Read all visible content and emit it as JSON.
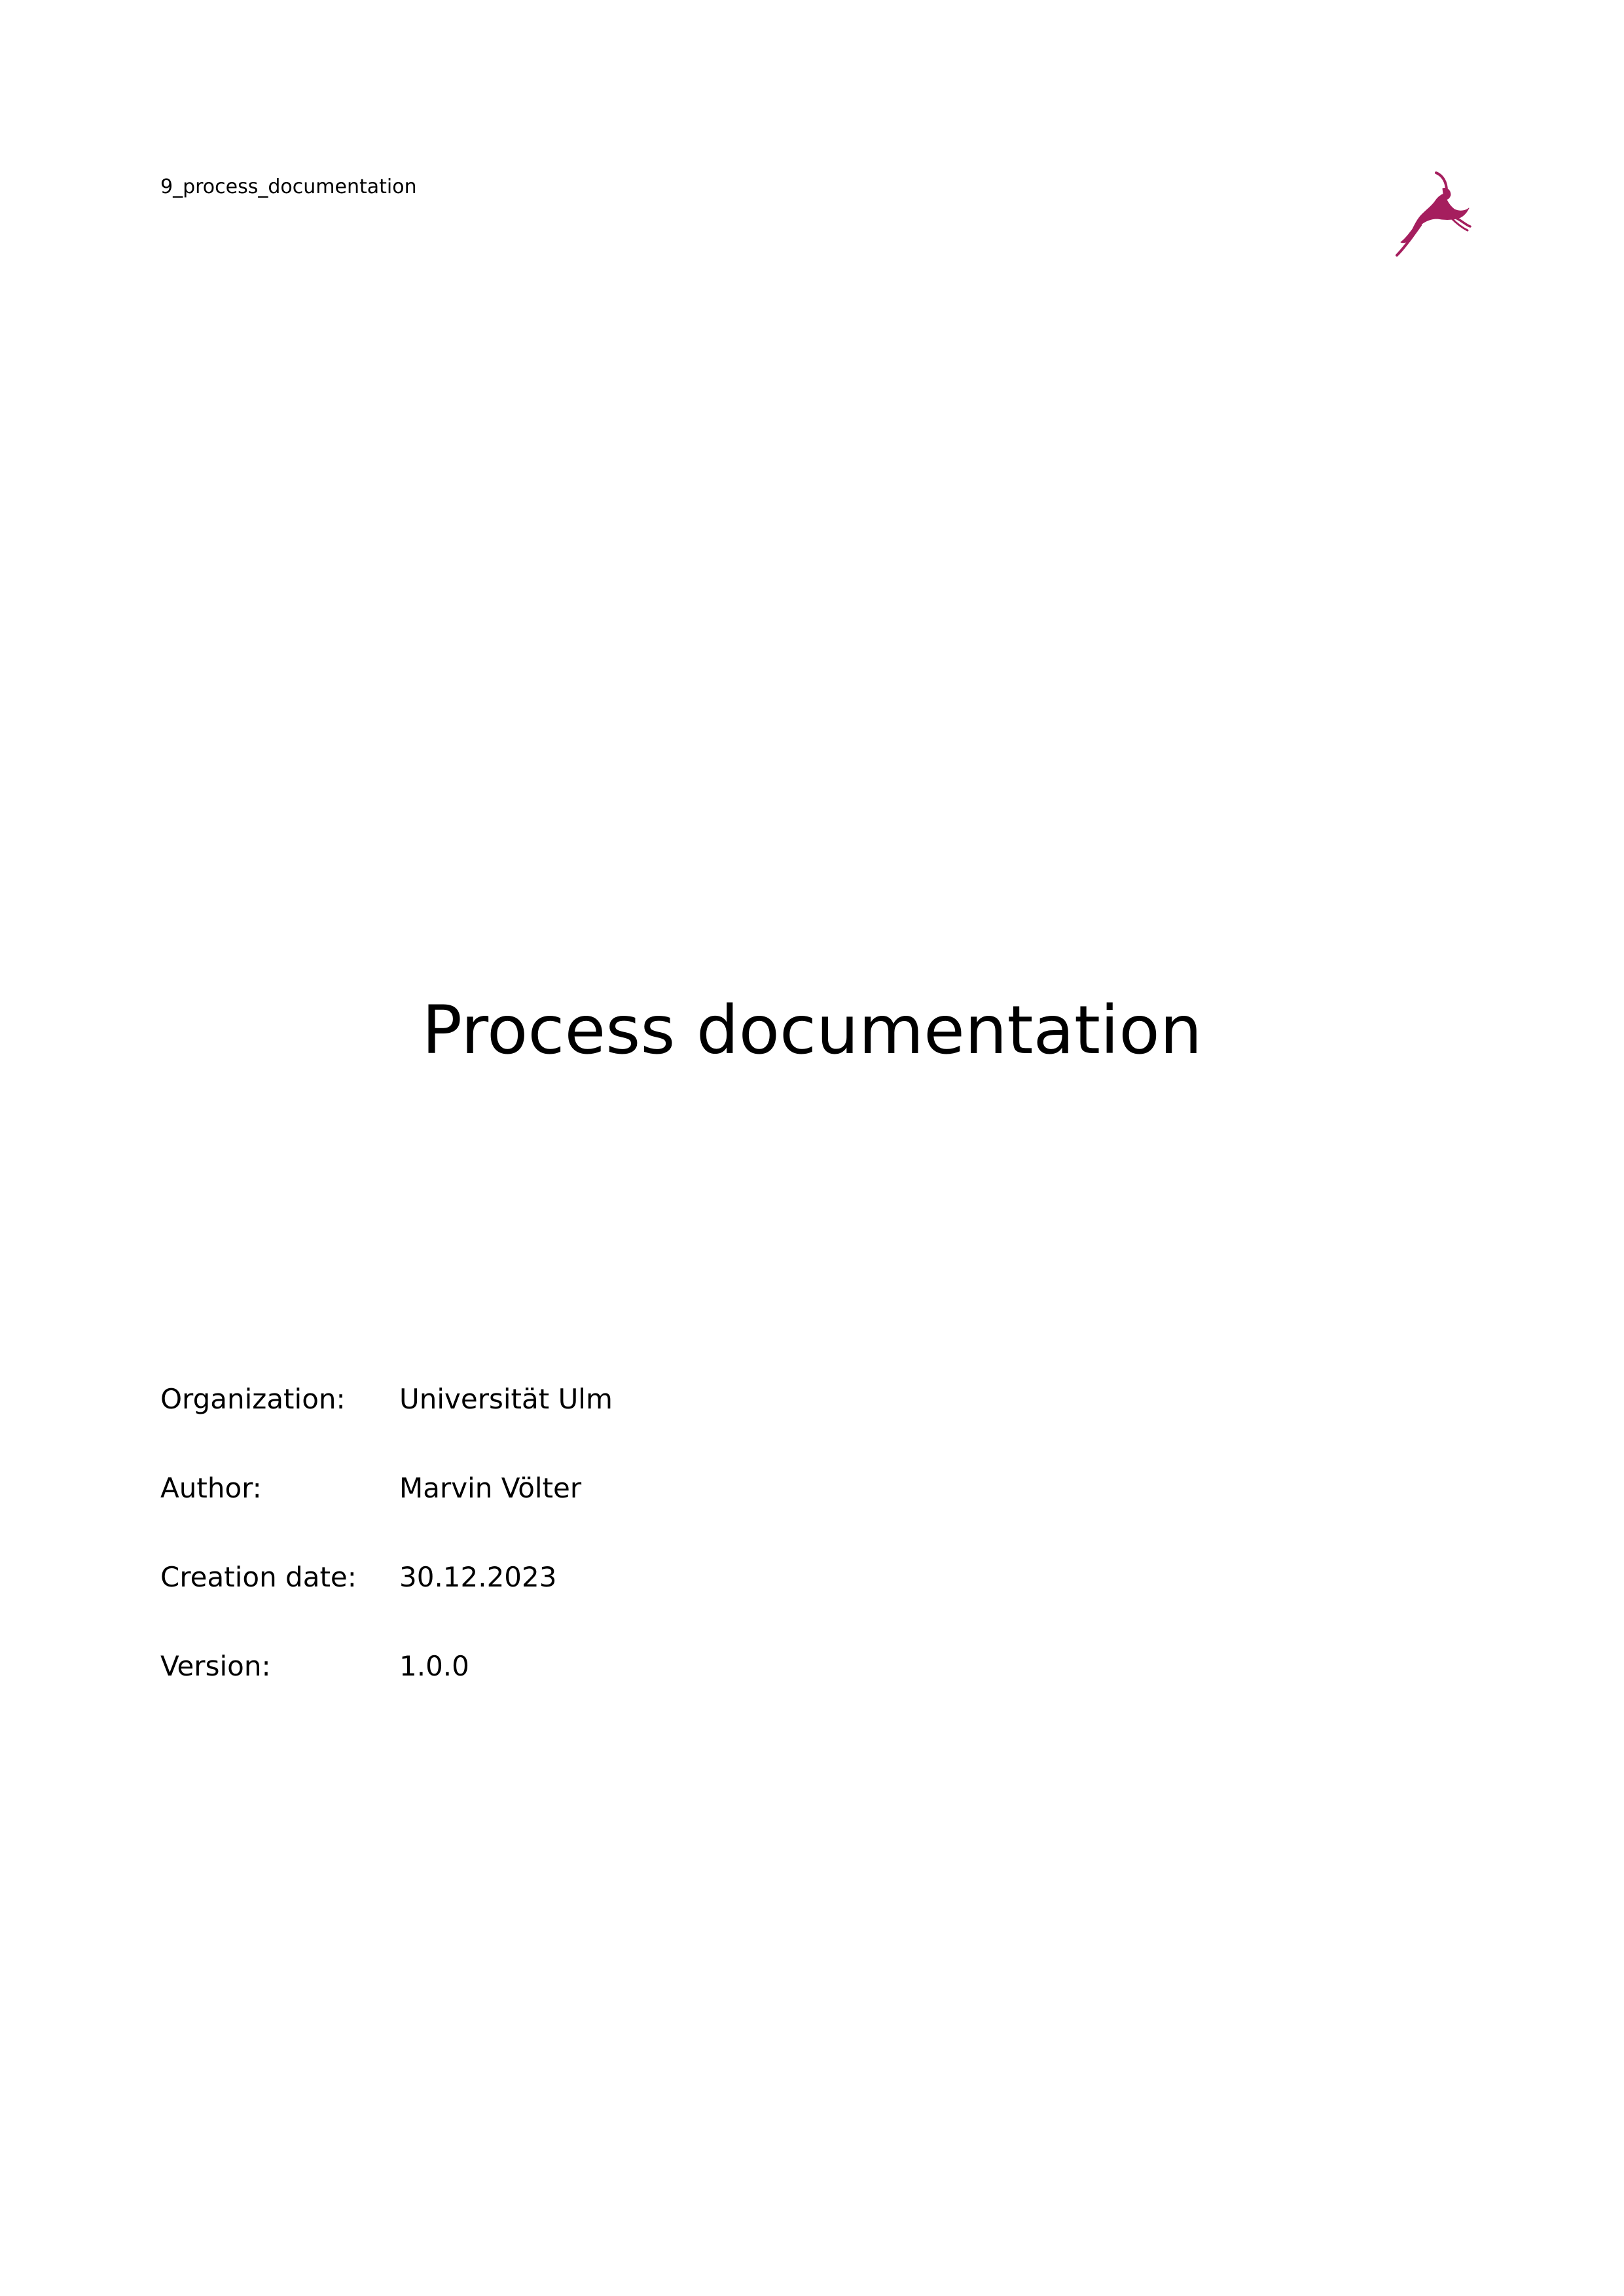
{
  "header": {
    "filename": "9_process_documentation",
    "logo_icon": "leaping-gazelle-icon",
    "logo_color": "#A51E5E"
  },
  "title": "Process documentation",
  "meta": [
    {
      "label": "Organization:",
      "value": "Universität Ulm"
    },
    {
      "label": "Author:",
      "value": "Marvin Völter"
    },
    {
      "label": "Creation date:",
      "value": "30.12.2023"
    },
    {
      "label": "Version:",
      "value": "1.0.0"
    }
  ]
}
